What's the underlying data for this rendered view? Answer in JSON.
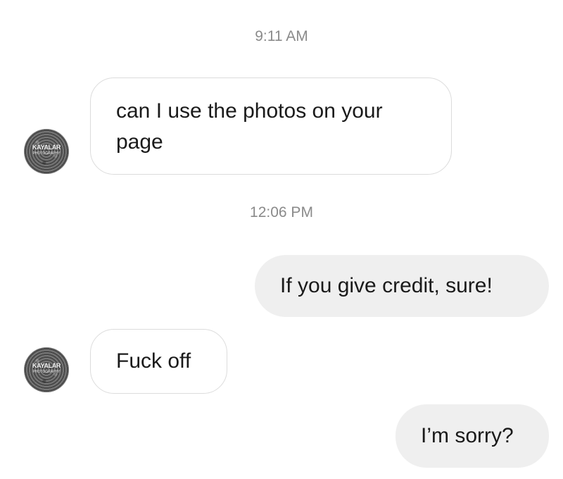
{
  "conversation": {
    "timestamps": [
      "9:11 AM",
      "12:06 PM"
    ],
    "messages": [
      {
        "sender": "other",
        "text": "can I use the photos on your page"
      },
      {
        "sender": "me",
        "text": "If you give credit, sure!"
      },
      {
        "sender": "other",
        "text": "Fuck off"
      },
      {
        "sender": "me",
        "text": "I’m sorry?"
      }
    ]
  },
  "avatar": {
    "logo_text": "KAYALAR",
    "logo_subtext": "PHOTOGRAPHY"
  },
  "colors": {
    "background": "#ffffff",
    "incoming_bubble": "#ffffff",
    "incoming_border": "#dcdcdc",
    "outgoing_bubble": "#efefef",
    "timestamp_text": "#8a8a8a",
    "message_text": "#1a1a1a"
  }
}
